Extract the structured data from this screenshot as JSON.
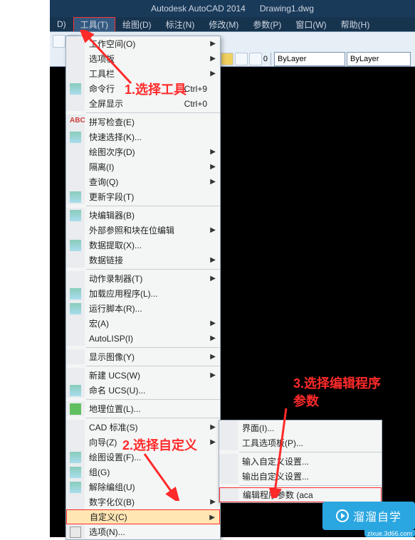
{
  "titlebar": {
    "app": "Autodesk AutoCAD 2014",
    "file": "Drawing1.dwg"
  },
  "menubar": {
    "items": [
      {
        "label": "D)"
      },
      {
        "label": "工具(T)",
        "active": true
      },
      {
        "label": "绘图(D)"
      },
      {
        "label": "标注(N)"
      },
      {
        "label": "修改(M)"
      },
      {
        "label": "参数(P)"
      },
      {
        "label": "窗口(W)"
      },
      {
        "label": "帮助(H)"
      }
    ]
  },
  "toolbar": {
    "layer1": "ByLayer",
    "layer2": "ByLayer"
  },
  "menu": {
    "items": [
      {
        "label": "工作空间(O)",
        "sub": true
      },
      {
        "label": "选项板",
        "sub": true
      },
      {
        "label": "工具栏",
        "sub": true
      },
      {
        "label": "命令行",
        "hot": "Ctrl+9",
        "icon": "cmdline"
      },
      {
        "label": "全屏显示",
        "hot": "Ctrl+0"
      },
      {
        "divider": true
      },
      {
        "label": "拼写检查(E)",
        "icon": "spell"
      },
      {
        "label": "快速选择(K)...",
        "icon": "qselect"
      },
      {
        "label": "绘图次序(D)",
        "sub": true
      },
      {
        "label": "隔离(I)",
        "sub": true
      },
      {
        "label": "查询(Q)",
        "sub": true
      },
      {
        "label": "更新字段(T)",
        "icon": "field"
      },
      {
        "divider": true
      },
      {
        "label": "块编辑器(B)",
        "icon": "block"
      },
      {
        "label": "外部参照和块在位编辑",
        "sub": true
      },
      {
        "label": "数据提取(X)...",
        "icon": "dataext"
      },
      {
        "label": "数据链接",
        "sub": true
      },
      {
        "divider": true
      },
      {
        "label": "动作录制器(T)",
        "sub": true
      },
      {
        "label": "加载应用程序(L)...",
        "icon": "appload"
      },
      {
        "label": "运行脚本(R)...",
        "icon": "script"
      },
      {
        "label": "宏(A)",
        "sub": true
      },
      {
        "label": "AutoLISP(I)",
        "sub": true
      },
      {
        "divider": true
      },
      {
        "label": "显示图像(Y)",
        "sub": true
      },
      {
        "divider": true
      },
      {
        "label": "新建 UCS(W)",
        "sub": true
      },
      {
        "label": "命名 UCS(U)...",
        "icon": "ucs"
      },
      {
        "divider": true
      },
      {
        "label": "地理位置(L)...",
        "icon": "geo"
      },
      {
        "divider": true
      },
      {
        "label": "CAD 标准(S)",
        "sub": true
      },
      {
        "label": "向导(Z)",
        "sub": true
      },
      {
        "label": "绘图设置(F)...",
        "icon": "dsettings"
      },
      {
        "label": "组(G)",
        "icon": "group"
      },
      {
        "label": "解除编组(U)",
        "icon": "ungroup"
      },
      {
        "label": "数字化仪(B)",
        "sub": true
      },
      {
        "label": "自定义(C)",
        "sub": true,
        "hl": true,
        "redbox": true
      },
      {
        "label": "选项(N)...",
        "icon": "options"
      }
    ]
  },
  "submenu": {
    "items": [
      {
        "label": "界面(I)...",
        "icon": "ui"
      },
      {
        "label": "工具选项板(P)...",
        "icon": "palette"
      },
      {
        "divider": true
      },
      {
        "label": "输入自定义设置..."
      },
      {
        "label": "输出自定义设置..."
      },
      {
        "divider": true
      },
      {
        "label": "编辑程序参数 (aca",
        "icon": "params",
        "redbox": true
      }
    ]
  },
  "annotations": {
    "a1": "1.选择工具",
    "a2": "2.选择自定义",
    "a3a": "3.选择编辑程序",
    "a3b": "参数"
  },
  "watermark": {
    "brand": "溜溜自学",
    "url": "zixue.3d66.com"
  }
}
